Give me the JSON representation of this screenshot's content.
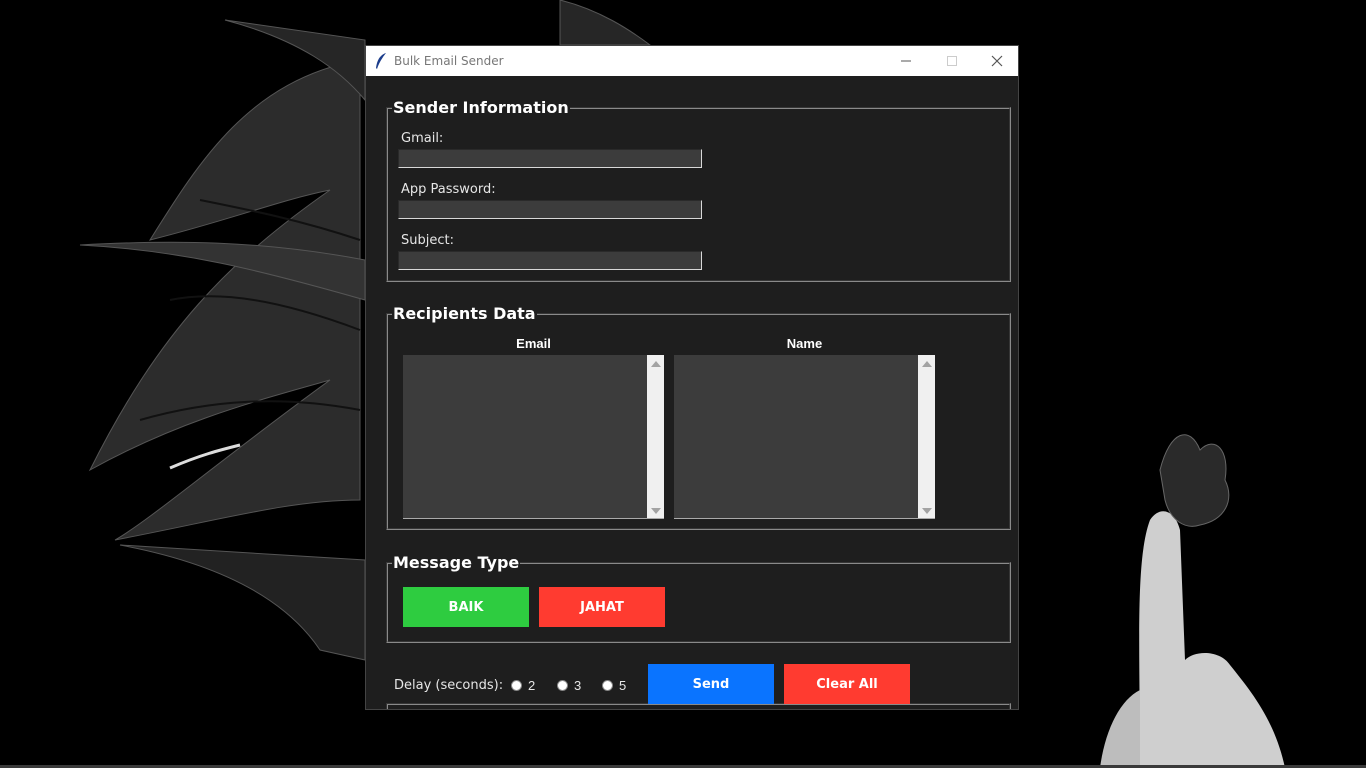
{
  "window": {
    "title": "Bulk Email Sender"
  },
  "sender": {
    "legend": "Sender Information",
    "gmail_label": "Gmail:",
    "password_label": "App Password:",
    "subject_label": "Subject:",
    "gmail_value": "",
    "password_value": "",
    "subject_value": ""
  },
  "recipients": {
    "legend": "Recipients Data",
    "email_header": "Email",
    "name_header": "Name"
  },
  "message": {
    "legend": "Message Type",
    "baik_label": "BAIK",
    "jahat_label": "JAHAT"
  },
  "controls": {
    "delay_label": "Delay (seconds):",
    "delay_options": [
      "2",
      "3",
      "5"
    ],
    "send_label": "Send",
    "clear_label": "Clear All"
  },
  "colors": {
    "baik": "#2ecc40",
    "jahat": "#ff3b30",
    "send": "#0a74ff",
    "clear": "#ff3b30"
  }
}
